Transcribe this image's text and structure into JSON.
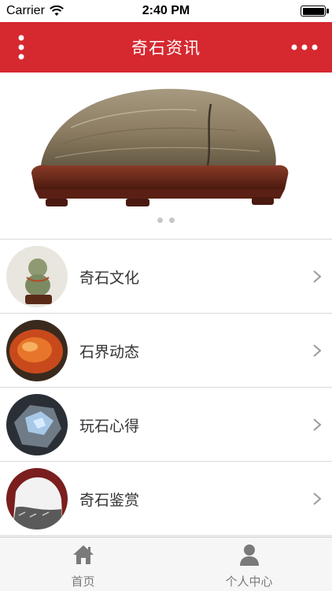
{
  "status": {
    "carrier": "Carrier",
    "time": "2:40 PM"
  },
  "nav": {
    "title": "奇石资讯",
    "left_icon": "vertical-dots-icon",
    "right_icon": "horizontal-dots-icon"
  },
  "banner": {
    "image": "stone-on-wooden-stand",
    "page_count": 2
  },
  "list": {
    "items": [
      {
        "label": "奇石文化",
        "thumb": "jade-figurine"
      },
      {
        "label": "石界动态",
        "thumb": "orange-agate"
      },
      {
        "label": "玩石心得",
        "thumb": "blue-labradorite"
      },
      {
        "label": "奇石鉴赏",
        "thumb": "white-black-stone"
      }
    ]
  },
  "tabs": {
    "home_label": "首页",
    "profile_label": "个人中心"
  },
  "colors": {
    "nav_bg": "#d6282f",
    "tab_icon": "#7a7a7a"
  }
}
